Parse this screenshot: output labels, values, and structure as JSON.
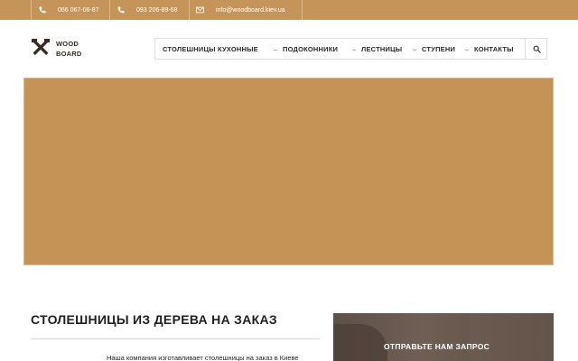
{
  "topbar": {
    "phone1": "066 067-08-87",
    "phone2": "093 206-89-68",
    "email": "info@woodboard.kiev.ua",
    "phone_icon": "phone-icon",
    "mail_icon": "envelope-icon"
  },
  "logo": {
    "line1": "WOOD",
    "line2": "BOARD",
    "icon": "crossed-tools-icon"
  },
  "nav": {
    "items": [
      "СТОЛЕШНИЦЫ КУХОННЫЕ",
      "ПОДОКОННИКИ",
      "ЛЕСТНИЦЫ",
      "СТУПЕНИ",
      "КОНТАКТЫ"
    ],
    "separator": "–",
    "search_icon": "search-icon"
  },
  "main": {
    "title": "СТОЛЕШНИЦЫ ИЗ ДЕРЕВА НА ЗАКАЗ",
    "intro": "Наша компания  изготавливает столешницы на заказ в Киеве"
  },
  "request": {
    "title": "ОТПРАВЬТЕ НАМ ЗАПРОС"
  },
  "colors": {
    "accent": "#c59458",
    "banner": "#c69356",
    "text_dark": "#1f1f1f",
    "panel_dark": "#5e5048"
  }
}
